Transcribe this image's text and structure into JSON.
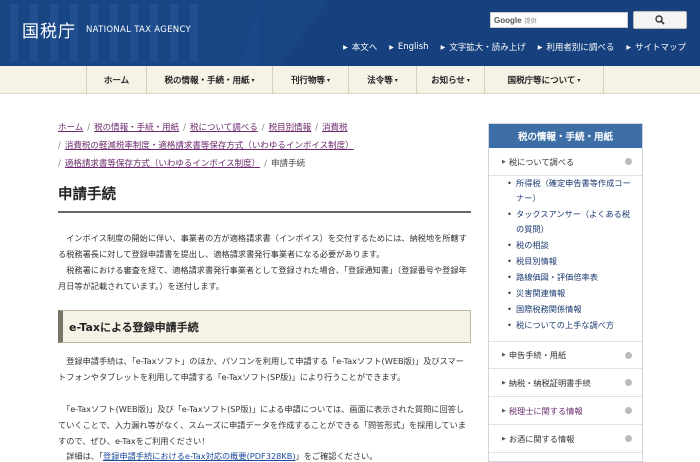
{
  "header": {
    "logo_jp": "国税庁",
    "logo_en": "NATIONAL TAX AGENCY",
    "search_brand": "Google",
    "search_hint": "提供",
    "search_icon": "magnifier-icon",
    "utility_links": [
      "本文へ",
      "English",
      "文字拡大・読み上げ",
      "利用者別に調べる",
      "サイトマップ"
    ],
    "colors": {
      "header_bg": "#16417e",
      "nav_bg": "#f6f2e6",
      "sidebar_title_bg": "#3d6fa6"
    }
  },
  "gnav": {
    "items": [
      {
        "label": "ホーム",
        "caret": ""
      },
      {
        "label": "税の情報・手続・用紙",
        "caret": "▾"
      },
      {
        "label": "刊行物等",
        "caret": "▾"
      },
      {
        "label": "法令等",
        "caret": "▾"
      },
      {
        "label": "お知らせ",
        "caret": "▾"
      },
      {
        "label": "国税庁等について",
        "caret": "▾"
      }
    ]
  },
  "breadcrumb": {
    "row1": [
      "ホーム",
      "税の情報・手続・用紙",
      "税について調べる",
      "税目別情報",
      "消費税"
    ],
    "row2": [
      "消費税の軽減税率制度・適格請求書等保存方式（いわゆるインボイス制度）"
    ],
    "row3_link": "適格請求書等保存方式（いわゆるインボイス制度）",
    "row3_current": "申請手続",
    "separator": "/"
  },
  "main": {
    "title": "申請手続",
    "intro": [
      "　インボイス制度の開始に伴い、事業者の方が適格請求書（インボイス）を交付するためには、納税地を所轄する税務署長に対して登録申請書を提出し、適格請求書発行事業者になる必要があります。",
      "　税務署における審査を経て、適格請求書発行事業者として登録された場合、「登録通知書」（登録番号や登録年月日等が記載されています。）を送付します。"
    ],
    "section_title": "e-Taxによる登録申請手続",
    "section_paras": [
      "　登録申請手続は、「e-Taxソフト」のほか、パソコンを利用して申請する「e-Taxソフト(WEB版)」及びスマートフォンやタブレットを利用して申請する「e-Taxソフト(SP版)」により行うことができます。",
      "　「e-Taxソフト(WEB版)」及び「e-Taxソフト(SP版)」による申請については、画面に表示された質問に回答していくことで、入力漏れ等がなく、スムーズに申請データを作成することができる「問答形式」を採用していますので、ぜひ、e-Taxをご利用ください！"
    ],
    "detail_prefix": "　詳細は、「",
    "detail_link": "登録申請手続におけるe-Tax対応の概要(PDF328KB)",
    "detail_suffix": "」をご確認ください。"
  },
  "sidebar": {
    "title": "税の情報・手続・用紙",
    "top_item": "税について調べる",
    "sub_items": [
      "所得税（確定申告書等作成コーナー）",
      "タックスアンサー（よくある税の質問）",
      "税の相談",
      "税目別情報",
      "路線価図・評価倍率表",
      "災害関連情報",
      "国際税務関係情報",
      "税についての上手な調べ方"
    ],
    "items": [
      "申告手続・用紙",
      "納税・納税証明書手続",
      "税理士に関する情報",
      "お酒に関する情報"
    ]
  }
}
